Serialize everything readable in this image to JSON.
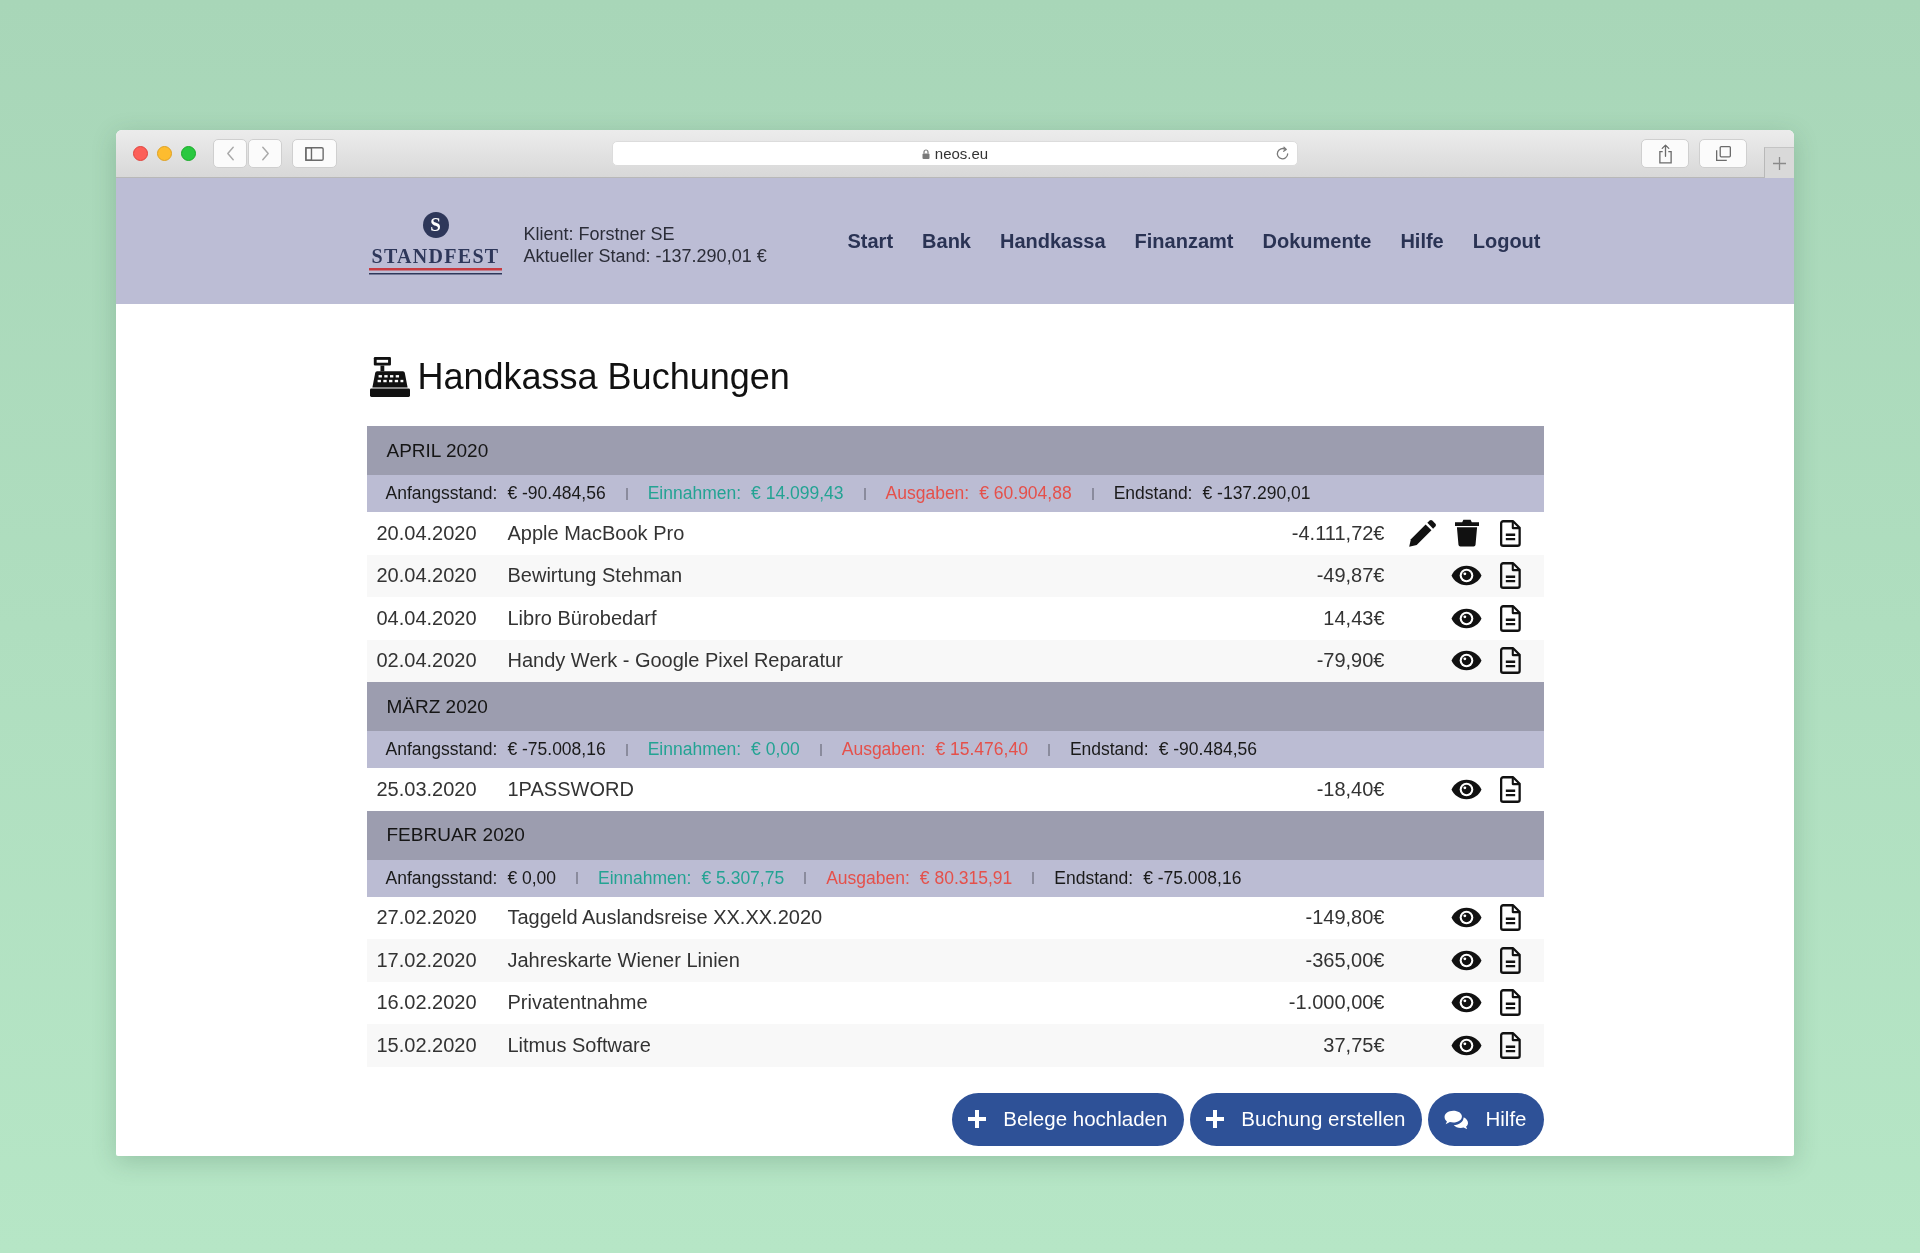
{
  "browser": {
    "url": "neos.eu"
  },
  "header": {
    "logo_letter": "S",
    "logo_text": "STANDFEST",
    "client": "Klient: Forstner SE",
    "balance": "Aktueller Stand: -137.290,01 €",
    "nav": [
      "Start",
      "Bank",
      "Handkassa",
      "Finanzamt",
      "Dokumente",
      "Hilfe",
      "Logout"
    ]
  },
  "page_title": "Handkassa Buchungen",
  "months": [
    {
      "title": "APRIL 2020",
      "summary": [
        {
          "kind": "neutral",
          "label": "Anfangsstand:",
          "value": "€ -90.484,56"
        },
        {
          "kind": "income",
          "label": "Einnahmen:",
          "value": "€ 14.099,43"
        },
        {
          "kind": "expense",
          "label": "Ausgaben:",
          "value": "€ 60.904,88"
        },
        {
          "kind": "neutral",
          "label": "Endstand:",
          "value": "€ -137.290,01"
        }
      ],
      "entries": [
        {
          "date": "20.04.2020",
          "description": "Apple MacBook Pro",
          "amount": "-4.111,72€",
          "actions": [
            {
              "kind": "edit"
            },
            {
              "kind": "delete"
            },
            {
              "kind": "document"
            }
          ]
        },
        {
          "date": "20.04.2020",
          "description": "Bewirtung Stehman",
          "amount": "-49,87€",
          "actions": [
            {
              "kind": "view"
            },
            {
              "kind": "document"
            }
          ]
        },
        {
          "date": "04.04.2020",
          "description": "Libro Bürobedarf",
          "amount": "14,43€",
          "actions": [
            {
              "kind": "view"
            },
            {
              "kind": "document"
            }
          ]
        },
        {
          "date": "02.04.2020",
          "description": "Handy Werk - Google Pixel Reparatur",
          "amount": "-79,90€",
          "actions": [
            {
              "kind": "view"
            },
            {
              "kind": "document"
            }
          ]
        }
      ]
    },
    {
      "title": "MÄRZ 2020",
      "summary": [
        {
          "kind": "neutral",
          "label": "Anfangsstand:",
          "value": "€ -75.008,16"
        },
        {
          "kind": "income",
          "label": "Einnahmen:",
          "value": "€ 0,00"
        },
        {
          "kind": "expense",
          "label": "Ausgaben:",
          "value": "€ 15.476,40"
        },
        {
          "kind": "neutral",
          "label": "Endstand:",
          "value": "€ -90.484,56"
        }
      ],
      "entries": [
        {
          "date": "25.03.2020",
          "description": "1PASSWORD",
          "amount": "-18,40€",
          "actions": [
            {
              "kind": "view"
            },
            {
              "kind": "document"
            }
          ]
        }
      ]
    },
    {
      "title": "FEBRUAR 2020",
      "summary": [
        {
          "kind": "neutral",
          "label": "Anfangsstand:",
          "value": "€ 0,00"
        },
        {
          "kind": "income",
          "label": "Einnahmen:",
          "value": "€ 5.307,75"
        },
        {
          "kind": "expense",
          "label": "Ausgaben:",
          "value": "€ 80.315,91"
        },
        {
          "kind": "neutral",
          "label": "Endstand:",
          "value": "€ -75.008,16"
        }
      ],
      "entries": [
        {
          "date": "27.02.2020",
          "description": "Taggeld Auslandsreise XX.XX.2020",
          "amount": "-149,80€",
          "actions": [
            {
              "kind": "view"
            },
            {
              "kind": "document"
            }
          ]
        },
        {
          "date": "17.02.2020",
          "description": "Jahreskarte Wiener Linien",
          "amount": "-365,00€",
          "actions": [
            {
              "kind": "view"
            },
            {
              "kind": "document"
            }
          ]
        },
        {
          "date": "16.02.2020",
          "description": "Privatentnahme",
          "amount": "-1.000,00€",
          "actions": [
            {
              "kind": "view"
            },
            {
              "kind": "document"
            }
          ]
        },
        {
          "date": "15.02.2020",
          "description": "Litmus Software",
          "amount": "37,75€",
          "actions": [
            {
              "kind": "view"
            },
            {
              "kind": "document"
            }
          ]
        }
      ]
    }
  ],
  "buttons": [
    {
      "kind": "plus",
      "label": "Belege hochladen"
    },
    {
      "kind": "plus",
      "label": "Buchung erstellen"
    },
    {
      "kind": "chat",
      "label": "Hilfe"
    }
  ]
}
